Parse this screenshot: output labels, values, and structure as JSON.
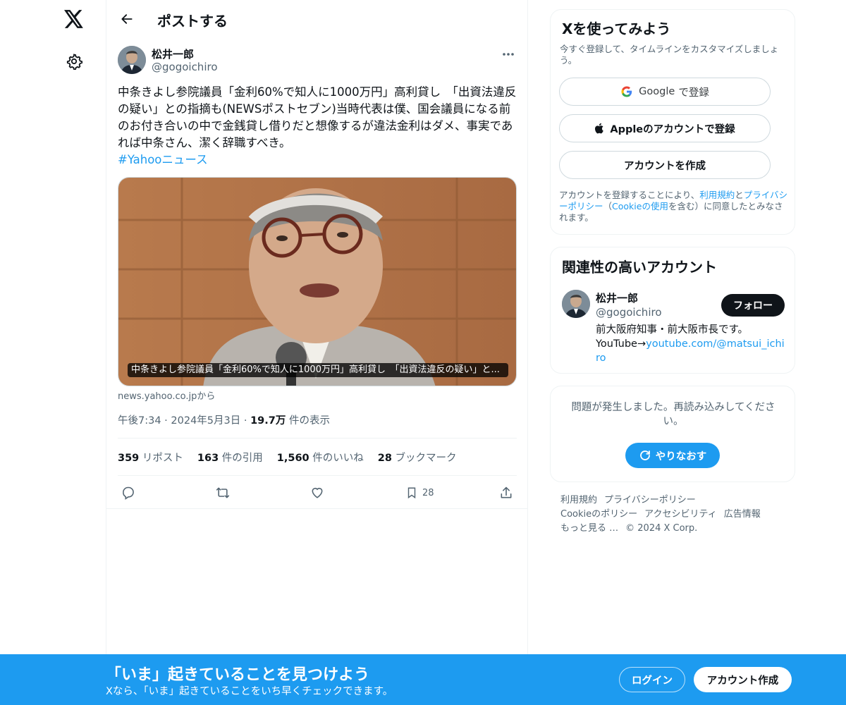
{
  "nav": {
    "logo_icon": "x-logo-icon",
    "settings_icon": "gear-icon"
  },
  "header": {
    "title": "ポストする",
    "back_icon": "arrow-left-icon"
  },
  "tweet": {
    "author_name": "松井一郎",
    "author_handle": "@gogoichiro",
    "text": "中条きよし参院議員「金利60%で知人に1000万円」高利貸し　「出資法違反の疑い」との指摘も(NEWSポストセブン)当時代表は僕、国会議員になる前のお付き合いの中で金銭貸し借りだと想像するが違法金利はダメ、事実であれば中条さん、潔く辞職すべき。",
    "hashtag": "#Yahooニュース",
    "media_caption": "中条きよし参院議員「金利60%で知人に1000万円」高利貸し　「出資法違反の疑い」と...",
    "media_source": "news.yahoo.co.jpから",
    "time": "午後7:34",
    "date": "2024年5月3日",
    "views_value": "19.7万",
    "views_label": "件の表示",
    "stats": {
      "reposts": "359",
      "reposts_label": "リポスト",
      "quotes": "163",
      "quotes_label": "件の引用",
      "likes": "1,560",
      "likes_label": "件のいいね",
      "bookmarks": "28",
      "bookmarks_label": "ブックマーク"
    },
    "action_bookmark_count": "28"
  },
  "signup_card": {
    "title": "Xを使ってみよう",
    "subtitle": "今すぐ登録して、タイムラインをカスタマイズしましょう。",
    "google_brand": "Google",
    "google_suffix": "で登録",
    "apple_label": "Appleのアカウントで登録",
    "create_label": "アカウントを作成",
    "legal_prefix": "アカウントを登録することにより、",
    "legal_terms": "利用規約",
    "legal_and": "と",
    "legal_privacy": "プライバシーポリシー",
    "legal_mid": "（",
    "legal_cookie": "Cookieの使用",
    "legal_suffix": "を含む）に同意したとみなされます。"
  },
  "related_card": {
    "title": "関連性の高いアカウント",
    "name": "松井一郎",
    "handle": "@gogoichiro",
    "follow_label": "フォロー",
    "bio_line1": "前大阪府知事・前大阪市長です。",
    "bio_prefix": "YouTube→",
    "bio_link": "youtube.com/@matsui_ichiro"
  },
  "error_card": {
    "message": "問題が発生しました。再読み込みしてください。",
    "retry_label": "やりなおす"
  },
  "footer": {
    "links": [
      "利用規約",
      "プライバシーポリシー",
      "Cookieのポリシー",
      "アクセシビリティ",
      "広告情報",
      "もっと見る …",
      "© 2024 X Corp."
    ]
  },
  "banner": {
    "title": "「いま」起きていることを見つけよう",
    "subtitle": "Xなら、「いま」起きていることをいち早くチェックできます。",
    "login_label": "ログイン",
    "signup_label": "アカウント作成"
  },
  "colors": {
    "accent": "#1d9bf0",
    "text": "#0f1419",
    "secondary": "#536471",
    "border": "#eff3f4"
  }
}
